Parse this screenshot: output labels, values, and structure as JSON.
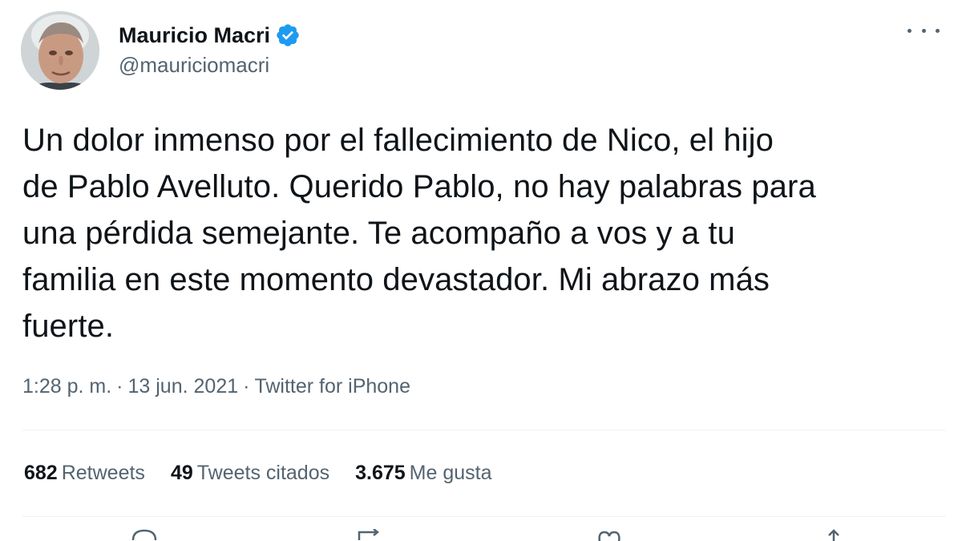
{
  "user": {
    "display_name": "Mauricio Macri",
    "handle": "@mauriciomacri",
    "verified": true
  },
  "tweet": {
    "lines": [
      "Un dolor inmenso por el fallecimiento de Nico, el hijo",
      "de Pablo Avelluto. Querido Pablo, no hay palabras para",
      "una pérdida semejante. Te acompaño a vos y a tu",
      "familia en este momento devastador. Mi abrazo más",
      "fuerte."
    ],
    "time": "1:28 p. m.",
    "date": "13 jun. 2021",
    "source": "Twitter for iPhone",
    "separator": "·"
  },
  "stats": {
    "retweets": {
      "count": "682",
      "label": "Retweets"
    },
    "quotes": {
      "count": "49",
      "label": "Tweets citados"
    },
    "likes": {
      "count": "3.675",
      "label": "Me gusta"
    }
  },
  "colors": {
    "text": "#0f1419",
    "secondary": "#536471",
    "verified": "#1d9bf0",
    "divider": "#eff3f4"
  },
  "icons": {
    "verified": "verified-badge-icon",
    "more": "more-options-icon",
    "reply": "reply-icon",
    "retweet": "retweet-icon",
    "like": "like-icon",
    "share": "share-icon"
  }
}
